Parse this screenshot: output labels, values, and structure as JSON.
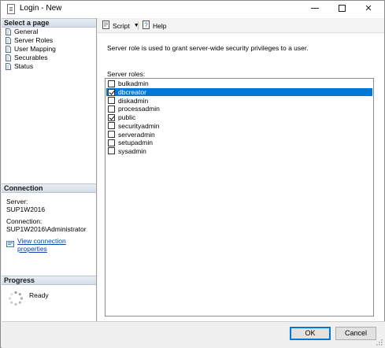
{
  "window": {
    "title": "Login - New"
  },
  "left_panel": {
    "select_page_header": "Select a page",
    "pages": [
      {
        "label": "General",
        "icon": "page-icon"
      },
      {
        "label": "Server Roles",
        "icon": "page-icon"
      },
      {
        "label": "User Mapping",
        "icon": "page-icon"
      },
      {
        "label": "Securables",
        "icon": "page-icon"
      },
      {
        "label": "Status",
        "icon": "page-icon"
      }
    ],
    "connection_header": "Connection",
    "server_label": "Server:",
    "server_value": "SUP1W2016",
    "connection_label": "Connection:",
    "connection_value": "SUP1W2016\\Administrator",
    "view_connection_link": "View connection properties",
    "progress_header": "Progress",
    "progress_status": "Ready"
  },
  "toolbar": {
    "script_label": "Script",
    "help_label": "Help"
  },
  "main": {
    "description": "Server role is used to grant server-wide security privileges to a user.",
    "roles_label": "Server roles:",
    "roles": [
      {
        "name": "bulkadmin",
        "checked": false,
        "selected": false
      },
      {
        "name": "dbcreator",
        "checked": true,
        "selected": true
      },
      {
        "name": "diskadmin",
        "checked": false,
        "selected": false
      },
      {
        "name": "processadmin",
        "checked": false,
        "selected": false
      },
      {
        "name": "public",
        "checked": true,
        "selected": false
      },
      {
        "name": "securityadmin",
        "checked": false,
        "selected": false
      },
      {
        "name": "serveradmin",
        "checked": false,
        "selected": false
      },
      {
        "name": "setupadmin",
        "checked": false,
        "selected": false
      },
      {
        "name": "sysadmin",
        "checked": false,
        "selected": false
      }
    ]
  },
  "footer": {
    "ok_label": "OK",
    "cancel_label": "Cancel"
  },
  "colors": {
    "selection": "#0078d7",
    "link": "#0645ad"
  }
}
